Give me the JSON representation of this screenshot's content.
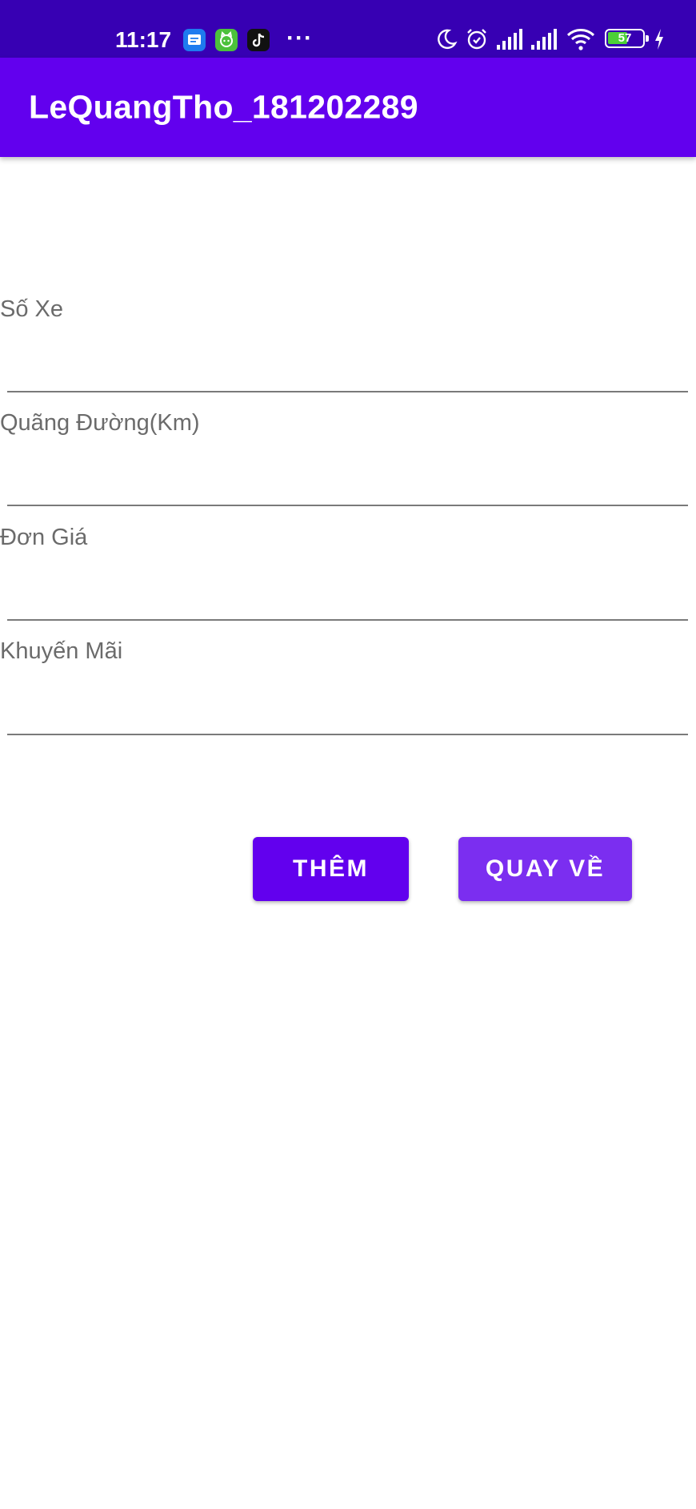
{
  "status_bar": {
    "time": "11:17",
    "battery_level": "57",
    "left_icons": [
      "messages-app-icon",
      "cat-app-icon",
      "tiktok-icon",
      "more-dots-icon"
    ],
    "right_icons": [
      "moon-icon",
      "alarm-icon",
      "signal-icon",
      "signal-icon",
      "wifi-icon",
      "battery-icon",
      "charging-icon"
    ],
    "more_label": "···"
  },
  "app_bar": {
    "title": "LeQuangTho_181202289",
    "color": "#6200EE"
  },
  "form": {
    "fields": [
      {
        "label": "Số Xe",
        "value": ""
      },
      {
        "label": "Quãng Đường(Km)",
        "value": ""
      },
      {
        "label": "Đơn Giá",
        "value": ""
      },
      {
        "label": "Khuyến Mãi",
        "value": ""
      }
    ]
  },
  "buttons": {
    "add_label": "THÊM",
    "back_label": "QUAY VỀ"
  },
  "colors": {
    "status_bar": "#3700B3",
    "primary": "#6200EE",
    "secondary_button": "#7B2EF0"
  }
}
